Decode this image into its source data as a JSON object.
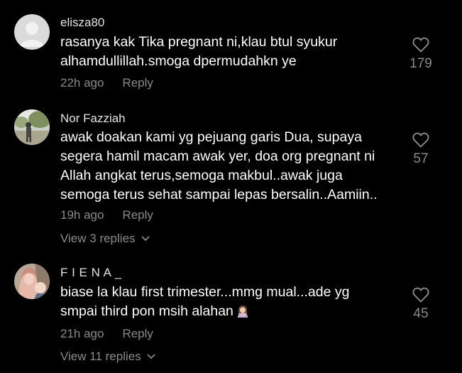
{
  "comments": [
    {
      "username": "elisza80",
      "avatar_icon": "default-avatar-icon",
      "lines": [
        "rasanya kak Tika pregnant ni,klau btul syukur",
        "alhamdullillah.smoga dpermudahkn ye"
      ],
      "time": "22h ago",
      "reply_label": "Reply",
      "likes": "179"
    },
    {
      "username": "Nor Fazziah",
      "avatar_icon": "photo-avatar-icon",
      "lines": [
        "awak doakan kami yg pejuang garis Dua, supaya",
        "segera hamil macam awak yer, doa org pregnant ni",
        "Allah angkat terus,semoga makbul..awak juga",
        "semoga terus sehat sampai lepas bersalin..Aamiin.."
      ],
      "time": "19h ago",
      "reply_label": "Reply",
      "likes": "57",
      "view_replies": "View 3 replies"
    },
    {
      "username": "F I E N A _",
      "avatar_icon": "photo-avatar-icon",
      "lines": [
        "biase la klau first trimester...mmg mual...ade yg",
        "smpai third pon msih alahan"
      ],
      "emoji_icon": "woman-gesturing-emoji-icon",
      "time": "21h ago",
      "reply_label": "Reply",
      "likes": "45",
      "view_replies": "View 11 replies"
    }
  ],
  "colors": {
    "background": "#000000",
    "text": "#ffffff",
    "muted": "#8a8a8a"
  }
}
